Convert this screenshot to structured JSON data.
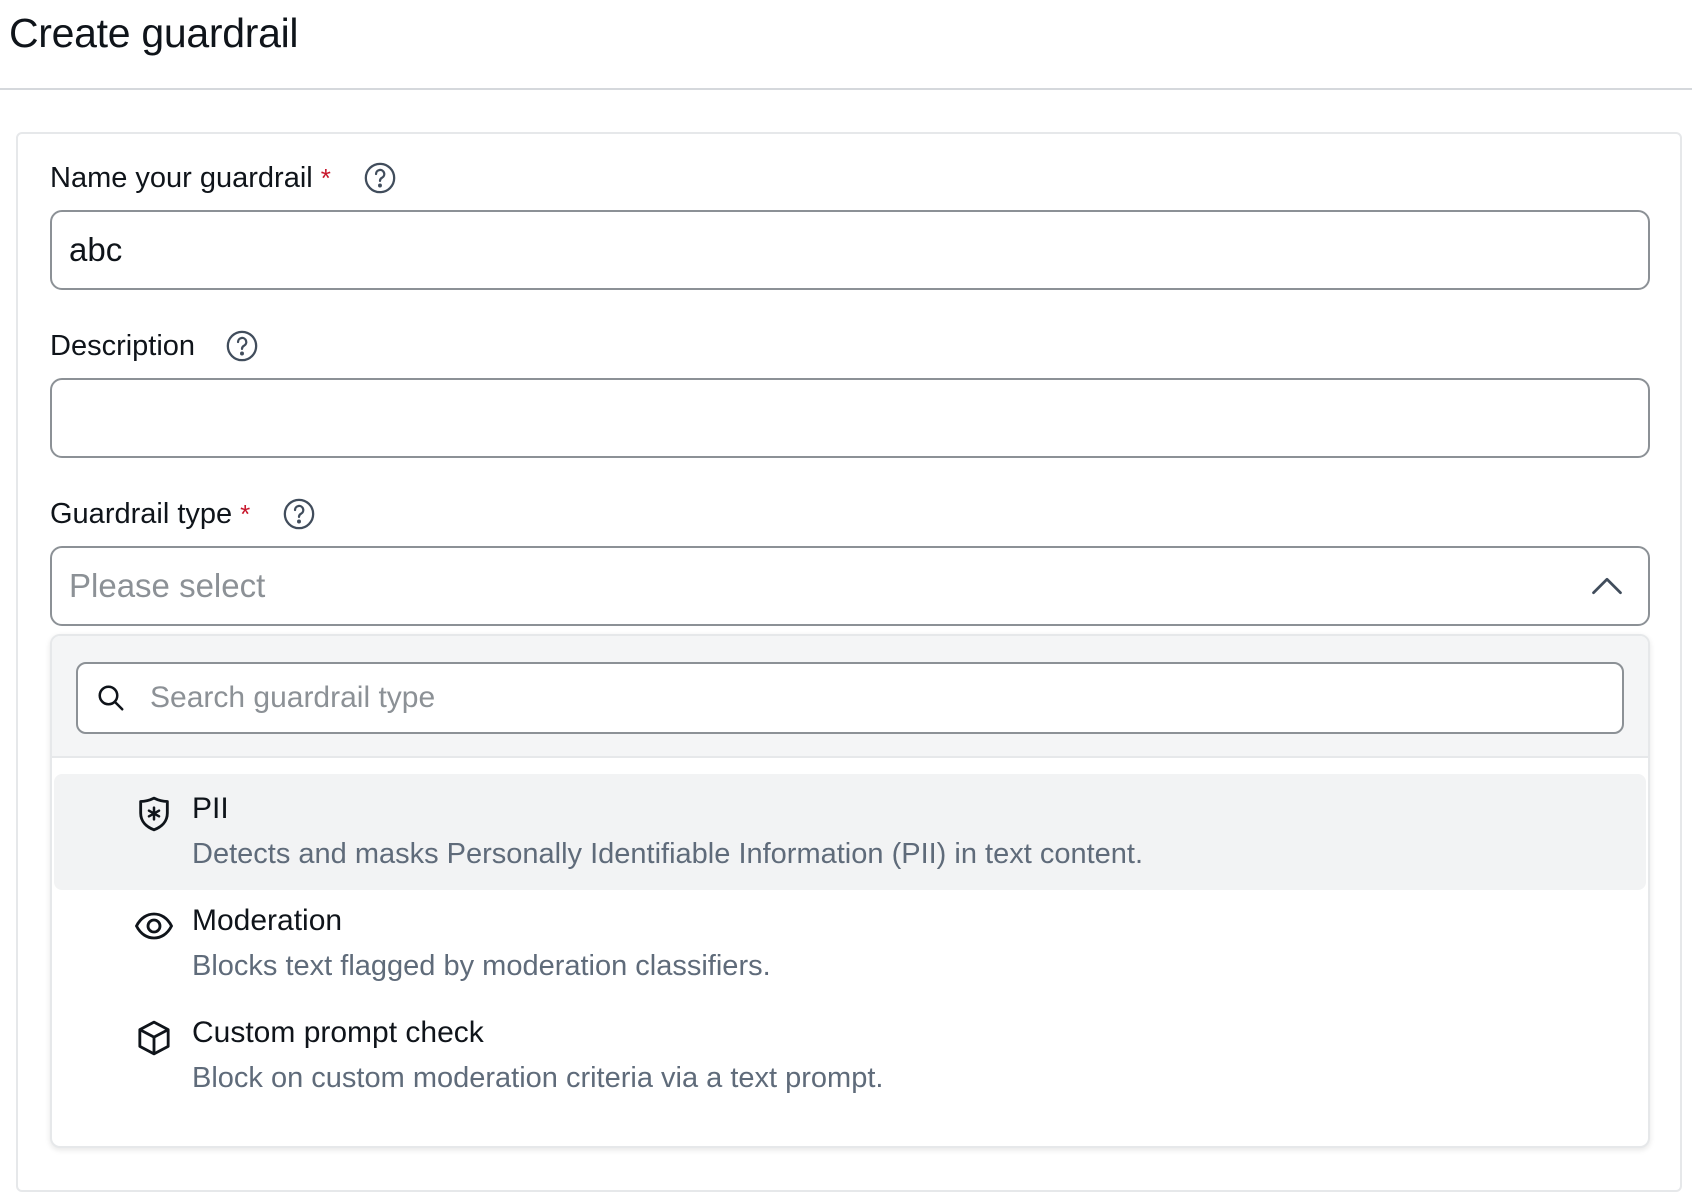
{
  "page": {
    "title": "Create guardrail"
  },
  "form": {
    "name": {
      "label": "Name your guardrail",
      "required_mark": "*",
      "value": "abc"
    },
    "description": {
      "label": "Description",
      "value": ""
    },
    "type": {
      "label": "Guardrail type",
      "required_mark": "*",
      "placeholder": "Please select",
      "expanded": true
    }
  },
  "dropdown": {
    "search_placeholder": "Search guardrail type",
    "options": [
      {
        "icon": "shield-star-icon",
        "title": "PII",
        "description": "Detects and masks Personally Identifiable Information (PII) in text content.",
        "highlighted": true
      },
      {
        "icon": "eye-icon",
        "title": "Moderation",
        "description": "Blocks text flagged by moderation classifiers.",
        "highlighted": false
      },
      {
        "icon": "cube-icon",
        "title": "Custom prompt check",
        "description": "Block on custom moderation criteria via a text prompt.",
        "highlighted": false
      }
    ]
  },
  "colors": {
    "required": "#c7162b",
    "border": "#8c9196",
    "muted_text": "#5f6b7a",
    "highlight_bg": "#f2f3f4"
  }
}
